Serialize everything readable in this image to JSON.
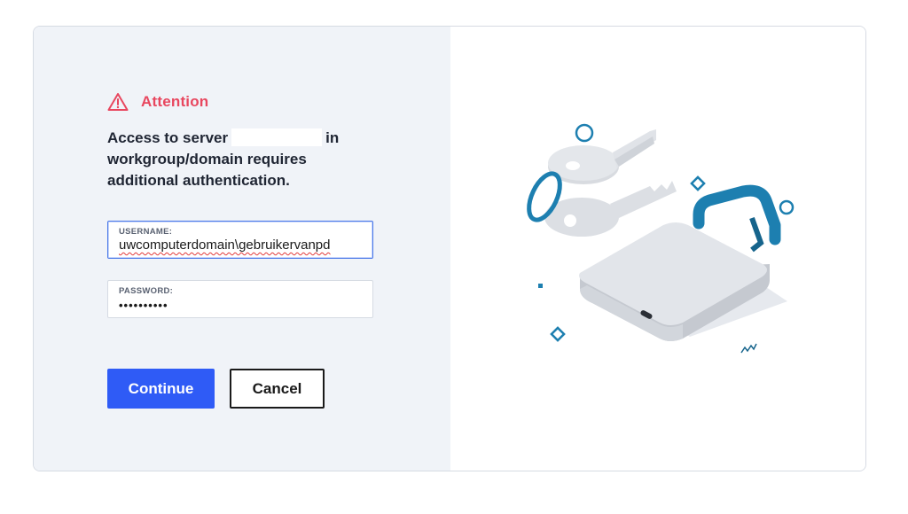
{
  "dialog": {
    "attention_title": "Attention",
    "message_prefix": "Access to server",
    "message_in": "in",
    "message_rest": "workgroup/domain requires additional authentication.",
    "username": {
      "label": "USERNAME:",
      "value": "uwcomputerdomain\\gebruikervanpd"
    },
    "password": {
      "label": "PASSWORD:",
      "masked_value": "••••••••••"
    },
    "continue_label": "Continue",
    "cancel_label": "Cancel"
  },
  "icons": {
    "attention": "warning-triangle-icon",
    "illustration": "padlock-with-keys-illustration"
  },
  "colors": {
    "accent": "#2f5bf6",
    "attention": "#e8475f",
    "left_panel_bg": "#f0f3f8",
    "illustration_blue": "#1d7fb0"
  }
}
